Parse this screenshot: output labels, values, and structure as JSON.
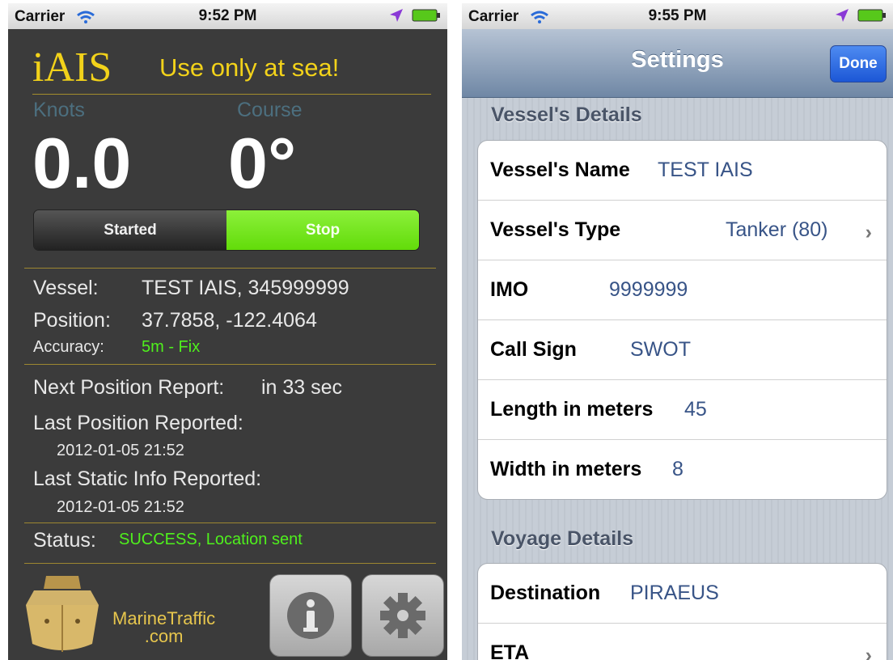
{
  "left": {
    "statusbar": {
      "carrier": "Carrier",
      "time": "9:52 PM"
    },
    "app_title": "iAIS",
    "warning": "Use only at sea!",
    "knots_label": "Knots",
    "knots_value": "0.0",
    "course_label": "Course",
    "course_value": "0°",
    "toggle": {
      "started": "Started",
      "stop": "Stop"
    },
    "vessel_label": "Vessel:",
    "vessel_value": "TEST IAIS, 345999999",
    "position_label": "Position:",
    "position_value": "37.7858, -122.4064",
    "accuracy_label": "Accuracy:",
    "accuracy_value": "5m - Fix",
    "next_report_label": "Next Position Report:",
    "next_report_value": "in 33 sec",
    "last_pos_label": "Last Position Reported:",
    "last_pos_value": "2012-01-05 21:52",
    "last_static_label": "Last Static Info Reported:",
    "last_static_value": "2012-01-05 21:52",
    "status_label": "Status:",
    "status_value": "SUCCESS, Location sent",
    "brand_line1": "MarineTraffic",
    "brand_line2": ".com",
    "colors": {
      "accent_yellow": "#f2d21a",
      "status_green": "#4ff01d",
      "label_blue": "#4c6f7f"
    }
  },
  "right": {
    "statusbar": {
      "carrier": "Carrier",
      "time": "9:55 PM"
    },
    "nav_title": "Settings",
    "done_label": "Done",
    "section_vessel": "Vessel's Details",
    "vessel_name_label": "Vessel's Name",
    "vessel_name_value": "TEST IAIS",
    "vessel_type_label": "Vessel's Type",
    "vessel_type_value": "Tanker (80)",
    "imo_label": "IMO",
    "imo_value": "9999999",
    "callsign_label": "Call Sign",
    "callsign_value": "SWOT",
    "length_label": "Length in meters",
    "length_value": "45",
    "width_label": "Width in meters",
    "width_value": "8",
    "section_voyage": "Voyage Details",
    "destination_label": "Destination",
    "destination_value": "PIRAEUS",
    "eta_label": "ETA",
    "colors": {
      "value_blue": "#385487",
      "done_blue": "#1c57d6"
    }
  }
}
